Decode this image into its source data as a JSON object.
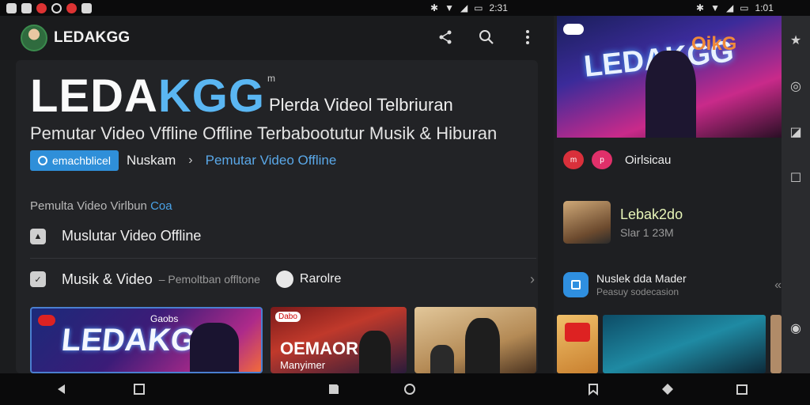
{
  "statusbar": {
    "time_left": "2:31",
    "time_right": "1:01"
  },
  "app": {
    "title": "LEDAKGG"
  },
  "hero": {
    "title_part1": "LEDA",
    "title_part2": "KGG",
    "superscript": "m",
    "right_heading": "Plerda Videol Telbriuran",
    "subtitle": "Pemutar Video Vffline Offline Terbabootutur Musik & Hiburan"
  },
  "chips": {
    "primary_label": "emachblicel",
    "crumb": "Nuskam",
    "separator": "›",
    "link": "Pemutar Video Offline"
  },
  "section": {
    "label": "Pemulta Video Virlbun",
    "accent": "Coa"
  },
  "rows": [
    {
      "label": "Muslutar Video Offline"
    },
    {
      "label": "Musik & Video",
      "sub": "– Pemoltban offltone",
      "extra": "Rarolre"
    }
  ],
  "thumbs": {
    "t1_small": "Gaobs",
    "t1_big": "LEDAKGG",
    "t2_chip": "Dabo",
    "t2_title": "OEMAOR",
    "t2_sub": "Manyimer"
  },
  "side": {
    "hero_title": "LEDAKGG",
    "hero_right": "OikG",
    "row1_badge1": "m",
    "row1_badge2": "p",
    "row1_label": "Oirlsicau",
    "item_title": "Lebak2do",
    "item_sub": "Slar 1 23M",
    "row3_title": "Nuslek dda Mader",
    "row3_sub": "Peasuy sodecasion",
    "chevron": "«"
  }
}
